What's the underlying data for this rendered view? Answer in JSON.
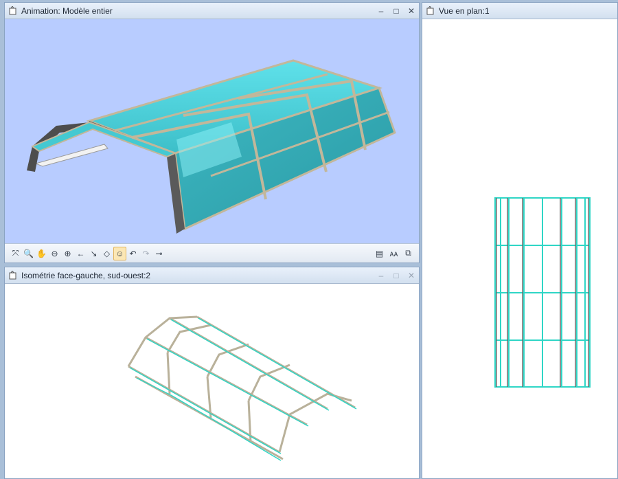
{
  "animation_window": {
    "title": "Animation: Modèle entier",
    "buttons": {
      "minimize": "–",
      "maximize": "□",
      "close": "✕"
    },
    "viewport_bg": "#b8ccff",
    "toolbar": {
      "tools": [
        {
          "name": "zoom-extents-icon",
          "glyph": "⤧"
        },
        {
          "name": "zoom-window-icon",
          "glyph": "🔍"
        },
        {
          "name": "pan-hand-icon",
          "glyph": "✋"
        },
        {
          "name": "zoom-out-icon",
          "glyph": "⊖"
        },
        {
          "name": "zoom-in-icon",
          "glyph": "⊕"
        },
        {
          "name": "previous-view-icon",
          "glyph": "←"
        },
        {
          "name": "axis-icon",
          "glyph": "↘"
        },
        {
          "name": "walk-icon",
          "glyph": "◇"
        },
        {
          "name": "camera-icon",
          "glyph": "☺"
        },
        {
          "name": "undo-view-icon",
          "glyph": "↶"
        },
        {
          "name": "redo-view-icon",
          "glyph": "↷"
        },
        {
          "name": "pin-icon",
          "glyph": "⊸"
        }
      ],
      "right_tools": [
        {
          "name": "render-settings-icon",
          "glyph": "▤"
        },
        {
          "name": "text-size-icon",
          "glyph": "ᴀᴀ"
        },
        {
          "name": "copy-view-icon",
          "glyph": "⧉"
        }
      ]
    }
  },
  "iso_window": {
    "title": "Isométrie face-gauche, sud-ouest:2",
    "buttons": {
      "minimize": "–",
      "maximize": "□",
      "close": "✕"
    }
  },
  "plan_window": {
    "title": "Vue en plan:1"
  },
  "colors": {
    "glass": "#3fc6cf",
    "frame": "#b6ae95",
    "wire_cyan": "#2fd6c6"
  }
}
